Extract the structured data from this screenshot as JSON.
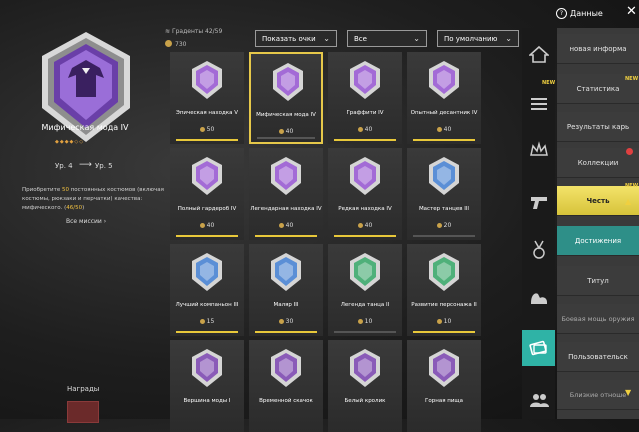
{
  "header": {
    "data_label": "Данные",
    "points_label": "Граденты",
    "points_value": "42/59",
    "coins_value": "730"
  },
  "filters": {
    "show_points": "Показать очки",
    "category": "Все",
    "sort": "По умолчанию"
  },
  "selected": {
    "title": "Мифическая мода IV",
    "level_from": "Ур. 4",
    "level_to": "Ур. 5",
    "desc_prefix": "Приобретите ",
    "desc_count": "50",
    "desc_mid": " постоянных костюмов (включая костюмы, рюкзаки и перчатки) качества: мифического. (",
    "desc_progress": "46/50",
    "desc_suffix": ")",
    "all_missions": "Все миссии"
  },
  "rewards_label": "Награды",
  "cards": [
    {
      "name": "Эпическая находка V",
      "pts": "50",
      "bar": "gold",
      "color": "#a36bd6"
    },
    {
      "name": "Мифическая мода IV",
      "pts": "40",
      "bar": "gray",
      "color": "#a36bd6"
    },
    {
      "name": "Граффити IV",
      "pts": "40",
      "bar": "gold",
      "color": "#a36bd6"
    },
    {
      "name": "Опытный десантник IV",
      "pts": "40",
      "bar": "gold",
      "color": "#a36bd6"
    },
    {
      "name": "Полный гардероб IV",
      "pts": "40",
      "bar": "gold",
      "color": "#a36bd6"
    },
    {
      "name": "Легендарная находка IV",
      "pts": "40",
      "bar": "gold",
      "color": "#a36bd6"
    },
    {
      "name": "Редкая находка IV",
      "pts": "40",
      "bar": "gold",
      "color": "#a36bd6"
    },
    {
      "name": "Мастер танцев III",
      "pts": "20",
      "bar": "gray",
      "color": "#5b8fd6"
    },
    {
      "name": "Лучший компаньон III",
      "pts": "15",
      "bar": "gold",
      "color": "#5b8fd6"
    },
    {
      "name": "Маляр III",
      "pts": "30",
      "bar": "gold",
      "color": "#5b8fd6"
    },
    {
      "name": "Легенда танца II",
      "pts": "10",
      "bar": "gray",
      "color": "#4fb07a"
    },
    {
      "name": "Развитие персонажа II",
      "pts": "10",
      "bar": "gold",
      "color": "#4fb07a"
    },
    {
      "name": "Вершина моды I",
      "pts": "",
      "bar": "none",
      "color": "#8a5bb8"
    },
    {
      "name": "Временной скачок",
      "pts": "",
      "bar": "none",
      "color": "#8a5bb8"
    },
    {
      "name": "Белый кролик",
      "pts": "",
      "bar": "none",
      "color": "#8a5bb8"
    },
    {
      "name": "Горная пища",
      "pts": "",
      "bar": "none",
      "color": "#8a5bb8"
    }
  ],
  "menu": [
    {
      "label": "новая информа",
      "style": "normal"
    },
    {
      "label": "Статистика",
      "style": "normal"
    },
    {
      "label": "Результаты карь",
      "style": "normal"
    },
    {
      "label": "Коллекции",
      "style": "normal"
    },
    {
      "label": "Честь",
      "style": "active"
    },
    {
      "label": "Достижения",
      "style": "sub"
    },
    {
      "label": "Титул",
      "style": "normal"
    },
    {
      "label": "Боевая мощь оружия",
      "style": "dim"
    },
    {
      "label": "Пользовательск",
      "style": "normal"
    },
    {
      "label": "Близкие отноше",
      "style": "dim"
    }
  ],
  "new_tag": "NEW"
}
